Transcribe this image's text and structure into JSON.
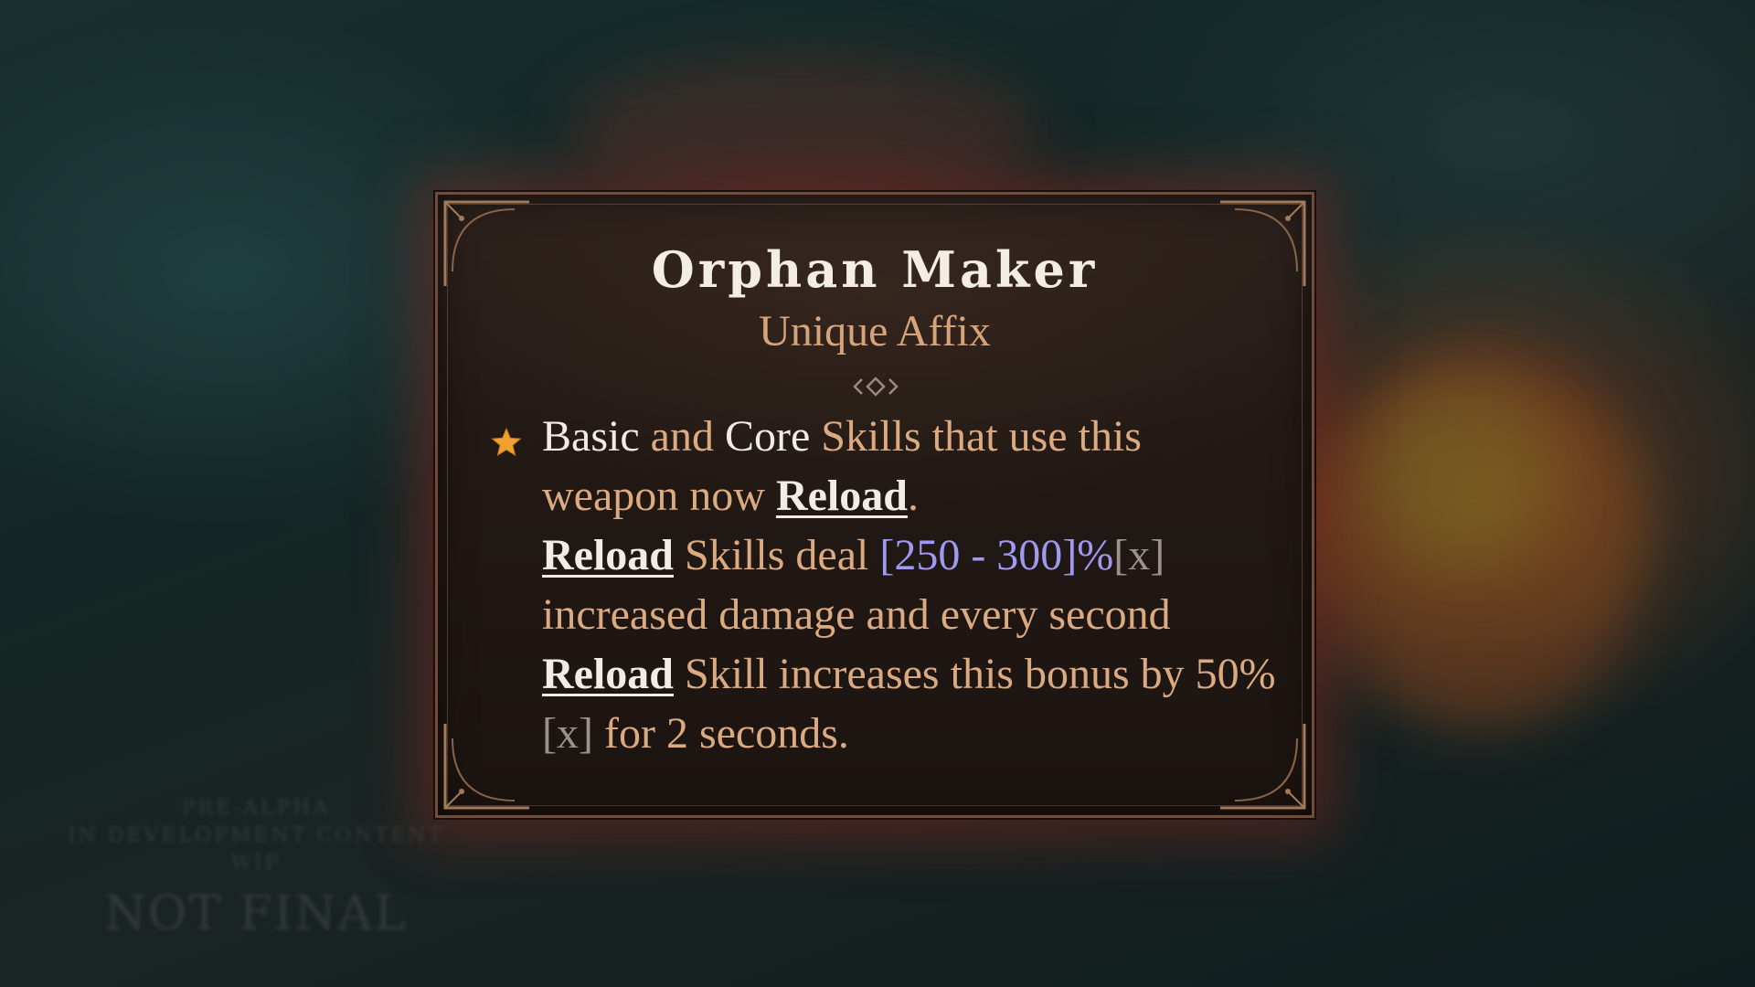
{
  "tooltip": {
    "title": "Orphan Maker",
    "subtitle": "Unique Affix",
    "icon": "star-icon",
    "affix": {
      "p1": "Basic",
      "p2": " and ",
      "p3": "Core",
      "p4": " Skills that use this weapon now ",
      "p5": "Reload",
      "p6": ".",
      "p7": "Reload",
      "p8": " Skills deal ",
      "p9": "[250 - 300]%",
      "p10": "[x]",
      "p11": " increased damage and every second ",
      "p12": "Reload",
      "p13": " Skill increases this bonus by ",
      "p14": "50%",
      "p15": "[x]",
      "p16": " for 2 seconds."
    }
  },
  "watermark": {
    "line1": "PRE-ALPHA",
    "line2": "IN DEVELOPMENT CONTENT",
    "line3": "WIP",
    "line4": "NOT FINAL"
  },
  "colors": {
    "title": "#f3ede6",
    "subtitle": "#d6a47a",
    "body_text": "#dcaa80",
    "keyword": "#f1ece6",
    "range_value": "#9f99f0",
    "multiplier_tag": "#9a938d",
    "star": "#f0a030"
  }
}
